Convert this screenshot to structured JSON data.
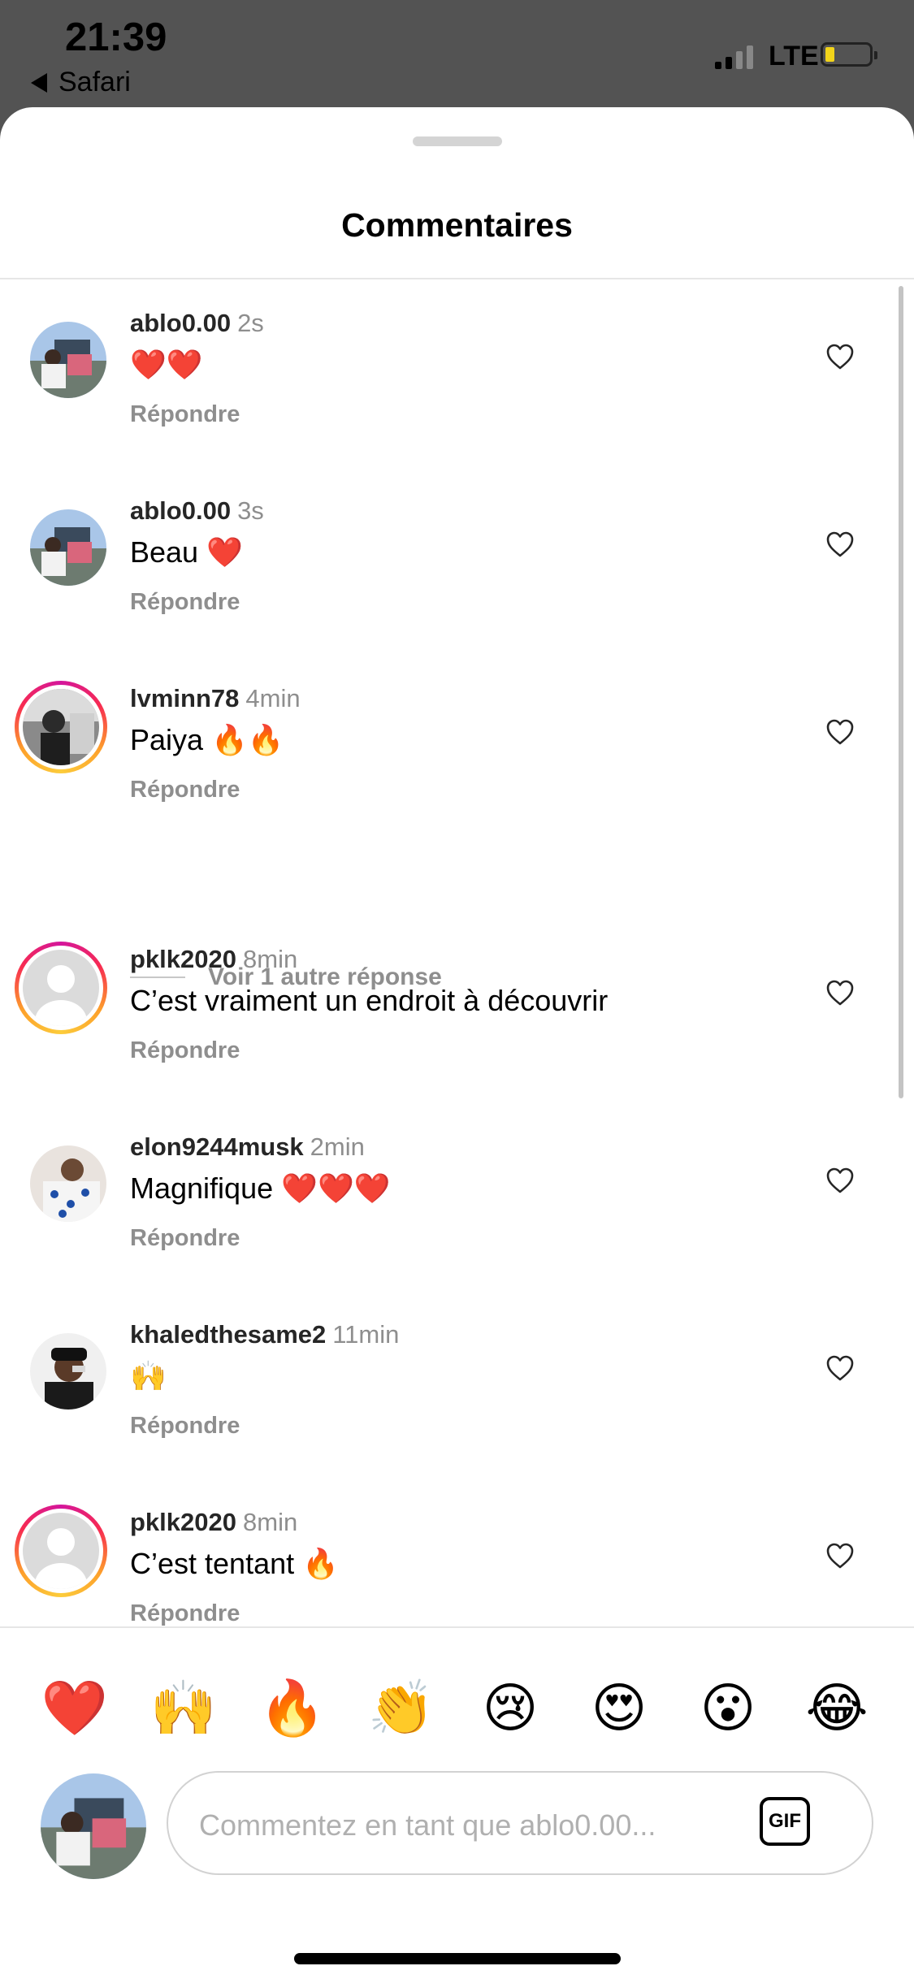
{
  "status_bar": {
    "time": "21:39",
    "back_app": "Safari",
    "network": "LTE"
  },
  "sheet": {
    "title": "Commentaires"
  },
  "comments": [
    {
      "username": "ablo0.00",
      "time": "2s",
      "text": "❤️❤️",
      "reply": "Répondre"
    },
    {
      "username": "ablo0.00",
      "time": "3s",
      "text": "Beau ❤️",
      "reply": "Répondre"
    },
    {
      "username": "lvminn78",
      "time": "4min",
      "text": "Paiya 🔥🔥",
      "reply": "Répondre"
    },
    {
      "username": "pklk2020",
      "time": "8min",
      "text": "C’est vraiment un endroit à découvrir",
      "reply": "Répondre"
    },
    {
      "username": "elon9244musk",
      "time": "2min",
      "text": "Magnifique ❤️❤️❤️",
      "reply": "Répondre"
    },
    {
      "username": "khaledthesame2",
      "time": "11min",
      "text": "🙌",
      "reply": "Répondre"
    },
    {
      "username": "pklk2020",
      "time": "8min",
      "text": "C’est tentant 🔥",
      "reply": "Répondre"
    }
  ],
  "more_replies": "Voir 1 autre réponse",
  "quick_reactions": [
    "❤️",
    "🙌",
    "🔥",
    "👏",
    "😢",
    "😍",
    "😮",
    "😂"
  ],
  "composer": {
    "placeholder": "Commentez en tant que ablo0.00...",
    "gif_label": "GIF"
  }
}
